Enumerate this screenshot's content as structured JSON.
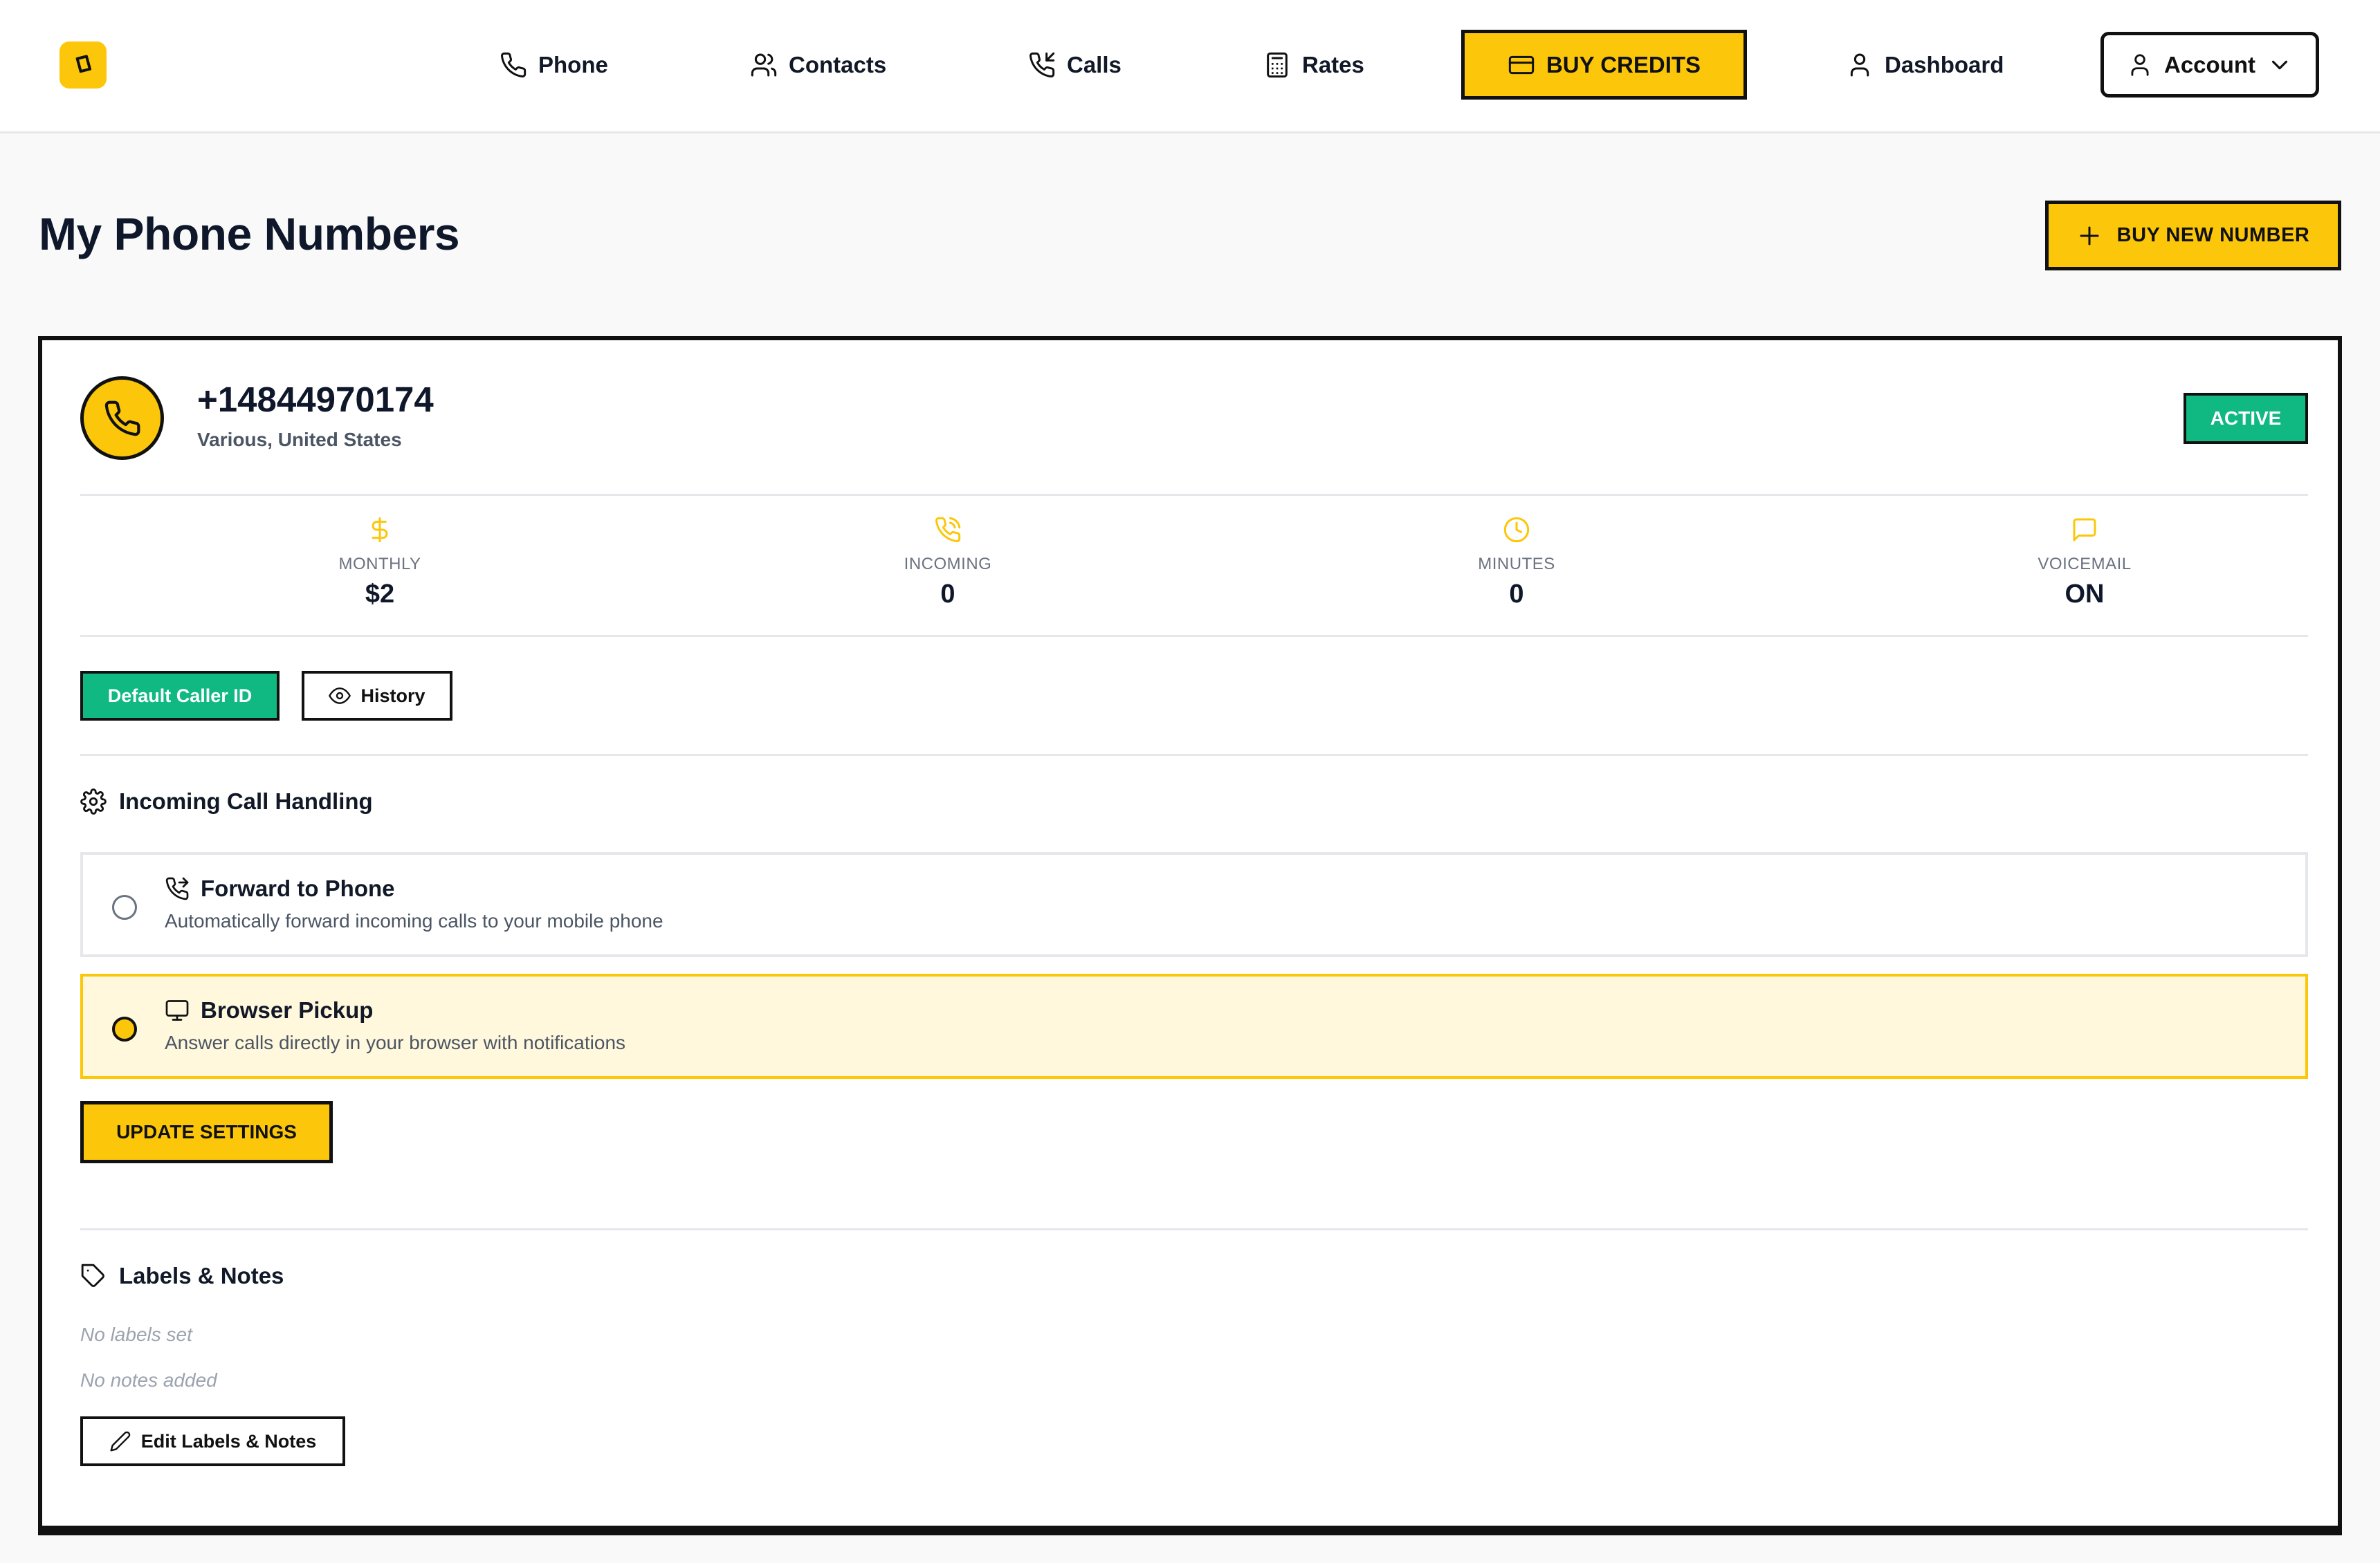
{
  "nav": {
    "items": [
      {
        "label": "Phone",
        "icon": "phone-icon"
      },
      {
        "label": "Contacts",
        "icon": "users-icon"
      },
      {
        "label": "Calls",
        "icon": "phone-incoming-icon"
      },
      {
        "label": "Rates",
        "icon": "calculator-icon"
      }
    ],
    "buy_credits": "BUY CREDITS",
    "dashboard": "Dashboard",
    "account": "Account"
  },
  "page": {
    "title": "My Phone Numbers",
    "buy_new_number": "BUY NEW NUMBER"
  },
  "number": {
    "value": "+14844970174",
    "location": "Various, United States",
    "status": "ACTIVE"
  },
  "stats": [
    {
      "label": "MONTHLY",
      "value": "$2",
      "icon": "dollar-icon"
    },
    {
      "label": "INCOMING",
      "value": "0",
      "icon": "phone-incoming-icon"
    },
    {
      "label": "MINUTES",
      "value": "0",
      "icon": "clock-icon"
    },
    {
      "label": "VOICEMAIL",
      "value": "ON",
      "icon": "message-icon"
    }
  ],
  "actions": {
    "default_caller_id": "Default Caller ID",
    "history": "History"
  },
  "call_handling": {
    "title": "Incoming Call Handling",
    "options": [
      {
        "title": "Forward to Phone",
        "description": "Automatically forward incoming calls to your mobile phone",
        "selected": false
      },
      {
        "title": "Browser Pickup",
        "description": "Answer calls directly in your browser with notifications",
        "selected": true
      }
    ],
    "update_button": "UPDATE SETTINGS"
  },
  "labels_notes": {
    "title": "Labels & Notes",
    "no_labels": "No labels set",
    "no_notes": "No notes added",
    "edit_button": "Edit Labels & Notes"
  },
  "colors": {
    "accent": "#fcc70a",
    "success": "#10b981",
    "text": "#111827"
  }
}
